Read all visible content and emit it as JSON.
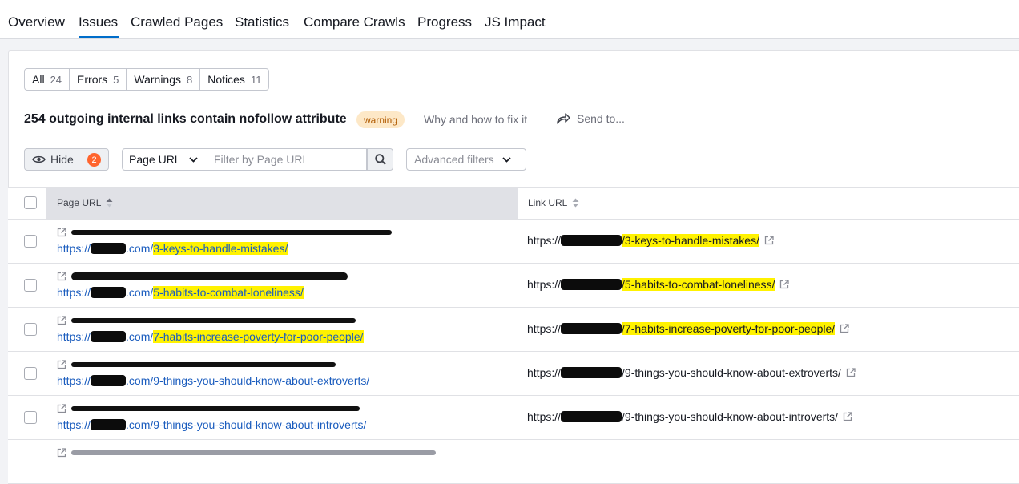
{
  "tabs": [
    {
      "label": "Overview"
    },
    {
      "label": "Issues"
    },
    {
      "label": "Crawled Pages"
    },
    {
      "label": "Statistics"
    },
    {
      "label": "Compare Crawls"
    },
    {
      "label": "Progress"
    },
    {
      "label": "JS Impact"
    }
  ],
  "filters": [
    {
      "label": "All",
      "count": "24"
    },
    {
      "label": "Errors",
      "count": "5"
    },
    {
      "label": "Warnings",
      "count": "8"
    },
    {
      "label": "Notices",
      "count": "11"
    }
  ],
  "issue": {
    "title": "254 outgoing internal links contain nofollow attribute",
    "badge": "warning",
    "why_link": "Why and how to fix it",
    "send_to": "Send to..."
  },
  "toolbar": {
    "hide_label": "Hide",
    "hide_count": "2",
    "select_value": "Page URL",
    "filter_placeholder": "Filter by Page URL",
    "advanced_label": "Advanced filters"
  },
  "table": {
    "columns": {
      "page_url": "Page URL",
      "link_url": "Link URL"
    },
    "rows": [
      {
        "page_prefix": "https://",
        "page_mid": ".com/",
        "page_slug": "3-keys-to-handle-mistakes/",
        "link_prefix": "https://",
        "link_slug": "/3-keys-to-handle-mistakes/",
        "highlight": true
      },
      {
        "page_prefix": "https://",
        "page_mid": ".com/",
        "page_slug": "5-habits-to-combat-loneliness/",
        "link_prefix": "https://",
        "link_slug": "/5-habits-to-combat-loneliness/",
        "highlight": true
      },
      {
        "page_prefix": "https://",
        "page_mid": ".com/",
        "page_slug": "7-habits-increase-poverty-for-poor-people/",
        "link_prefix": "https://",
        "link_slug": "/7-habits-increase-poverty-for-poor-people/",
        "highlight": true
      },
      {
        "page_prefix": "https://",
        "page_mid": ".com/",
        "page_slug": "9-things-you-should-know-about-extroverts/",
        "link_prefix": "https://",
        "link_slug": "/9-things-you-should-know-about-extroverts/",
        "highlight": false
      },
      {
        "page_prefix": "https://",
        "page_mid": ".com/",
        "page_slug": "9-things-you-should-know-about-introverts/",
        "link_prefix": "https://",
        "link_slug": "/9-things-you-should-know-about-introverts/",
        "highlight": false
      }
    ]
  },
  "colors": {
    "accent": "#006dca",
    "link": "#1a5cbe",
    "highlight": "#fff200",
    "badge_bg": "#fde8c7",
    "badge_fg": "#b05a00",
    "counter": "#ff642d"
  }
}
